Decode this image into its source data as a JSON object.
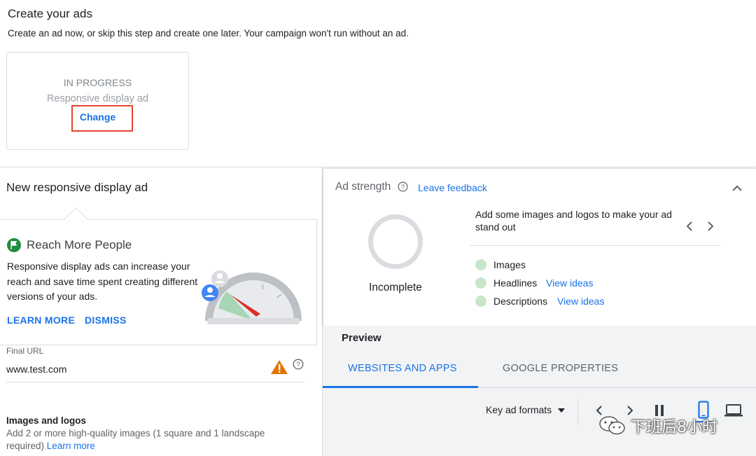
{
  "header": {
    "title": "Create your ads",
    "subtitle": "Create an ad now, or skip this step and create one later. Your campaign won't run without an ad."
  },
  "ad_card": {
    "status": "IN PROGRESS",
    "type": "Responsive display ad",
    "change_label": "Change"
  },
  "left_panel": {
    "title": "New responsive display ad",
    "reach": {
      "title": "Reach More People",
      "description": "Responsive display ads can increase your reach and save time spent creating different versions of your ads.",
      "learn_more": "LEARN MORE",
      "dismiss": "DISMISS"
    },
    "final_url": {
      "label": "Final URL",
      "value": "www.test.com"
    },
    "images_logos": {
      "title": "Images and logos",
      "description": "Add 2 or more high-quality images (1 square and 1 landscape required)",
      "link": "Learn more"
    }
  },
  "ad_strength": {
    "title": "Ad strength",
    "leave_feedback": "Leave feedback",
    "status": "Incomplete",
    "tip": "Add some images and logos to make your ad stand out",
    "checklist": [
      {
        "label": "Images",
        "link": ""
      },
      {
        "label": "Headlines",
        "link": "View ideas"
      },
      {
        "label": "Descriptions",
        "link": "View ideas"
      }
    ]
  },
  "preview": {
    "title": "Preview",
    "tabs": [
      {
        "label": "WEBSITES AND APPS",
        "active": true
      },
      {
        "label": "GOOGLE PROPERTIES",
        "active": false
      }
    ],
    "key_formats": "Key ad formats"
  },
  "watermark": {
    "text": "下班后8小时"
  },
  "colors": {
    "accent": "#1a73e8",
    "highlight_box": "#e8452c",
    "success": "#1e8e3e",
    "warning": "#e37400",
    "checklist_dot": "#c8e6c9"
  }
}
